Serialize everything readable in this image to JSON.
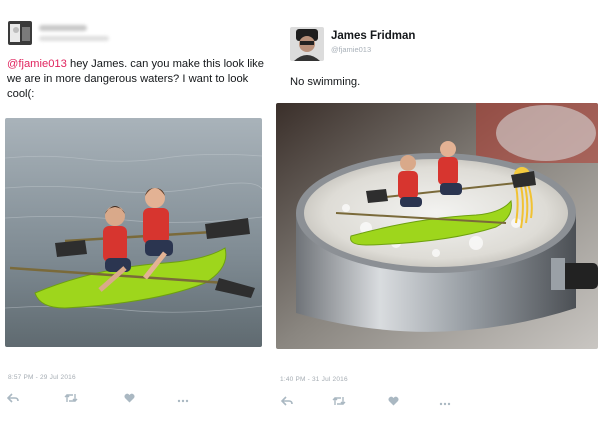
{
  "left_tweet": {
    "handle_mention": "@fjamie013",
    "text": " hey James. can you make this look like we are in more dangerous waters? I want to look cool(:",
    "timestamp": "8:57 PM - 29 Jul 2016"
  },
  "right_tweet": {
    "name": "James Fridman",
    "handle": "@fjamie013",
    "text": "No swimming.",
    "timestamp": "1:40 PM - 31 Jul 2016"
  },
  "icons": [
    "reply-icon",
    "retweet-icon",
    "like-icon",
    "more-icon"
  ],
  "colors": {
    "mention": "#e0245e",
    "kayak": "#9ed61c",
    "water": "#7d8a93"
  }
}
